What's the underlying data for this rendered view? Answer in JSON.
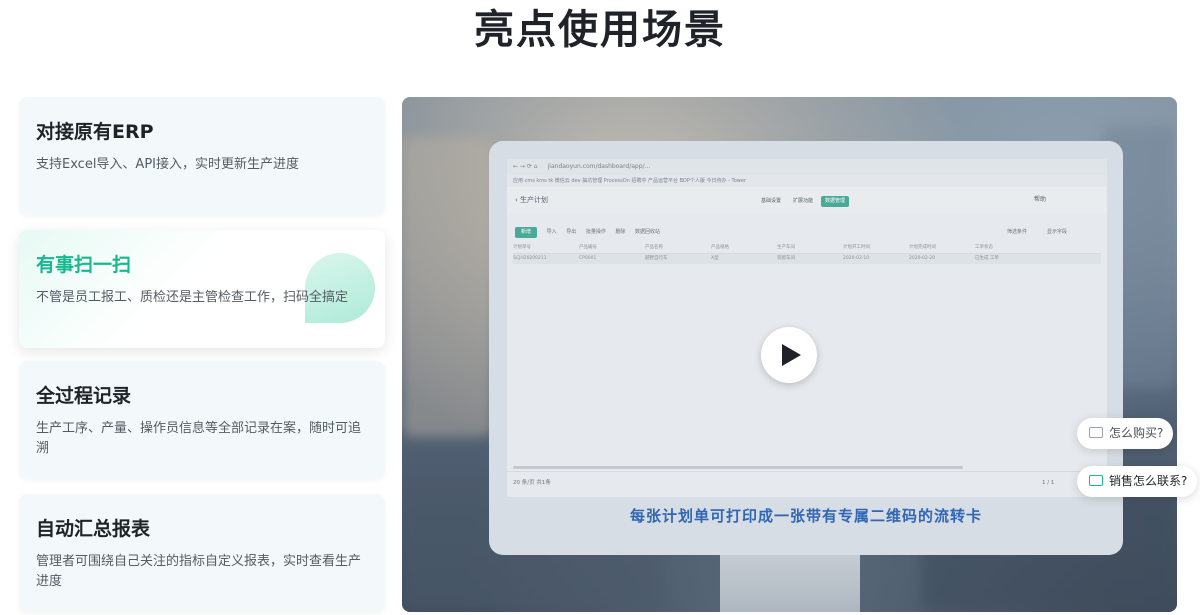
{
  "page_title": "亮点使用场景",
  "cards": [
    {
      "title": "对接原有ERP",
      "desc": "支持Excel导入、API接入，实时更新生产进度"
    },
    {
      "title": "有事扫一扫",
      "desc": "不管是员工报工、质检还是主管检查工作，扫码全搞定"
    },
    {
      "title": "全过程记录",
      "desc": "生产工序、产量、操作员信息等全部记录在案，随时可追溯"
    },
    {
      "title": "自动汇总报表",
      "desc": "管理者可围绕自己关注的指标自定义报表，实时查看生产进度"
    }
  ],
  "video": {
    "caption": "每张计划单可打印成一张带有专属二维码的流转卡",
    "screen": {
      "url": "jiandaoyun.com/dashboard/app/...",
      "bookmarks": "应用  cms  kms  tk  微信云  dev  抽坑管理  ProcessOn  招聘中  产品运营平台  BDP个人版  今日待办 - Tower",
      "app_title": "生产计划",
      "tabs": [
        "基础设置",
        "扩展功能",
        "数据管理"
      ],
      "help": "帮助",
      "toolbar": [
        "新增",
        "导入",
        "导出",
        "批量操作",
        "删除",
        "数据回收站"
      ],
      "toolbar_right": [
        "筛选条件",
        "显示字段"
      ],
      "columns": [
        "计划单号",
        "产品编号",
        "产品名称",
        "产品规格",
        "生产车间",
        "计划开工时间",
        "计划完成时间",
        "工单状态"
      ],
      "row": [
        "SCJH20200211",
        "CP0001",
        "越野自行车",
        "X型",
        "装配车间",
        "2020-02-10",
        "2020-02-20",
        "已生成 工单"
      ],
      "footer": "20 条/页    共1条",
      "pagination": "1  /  1"
    }
  },
  "floating": {
    "how_to_buy": "怎么购买?",
    "contact_sales": "销售怎么联系?"
  },
  "colors": {
    "accent": "#17b890",
    "caption": "#2f66b5",
    "card_bg": "#f3f9fa"
  }
}
